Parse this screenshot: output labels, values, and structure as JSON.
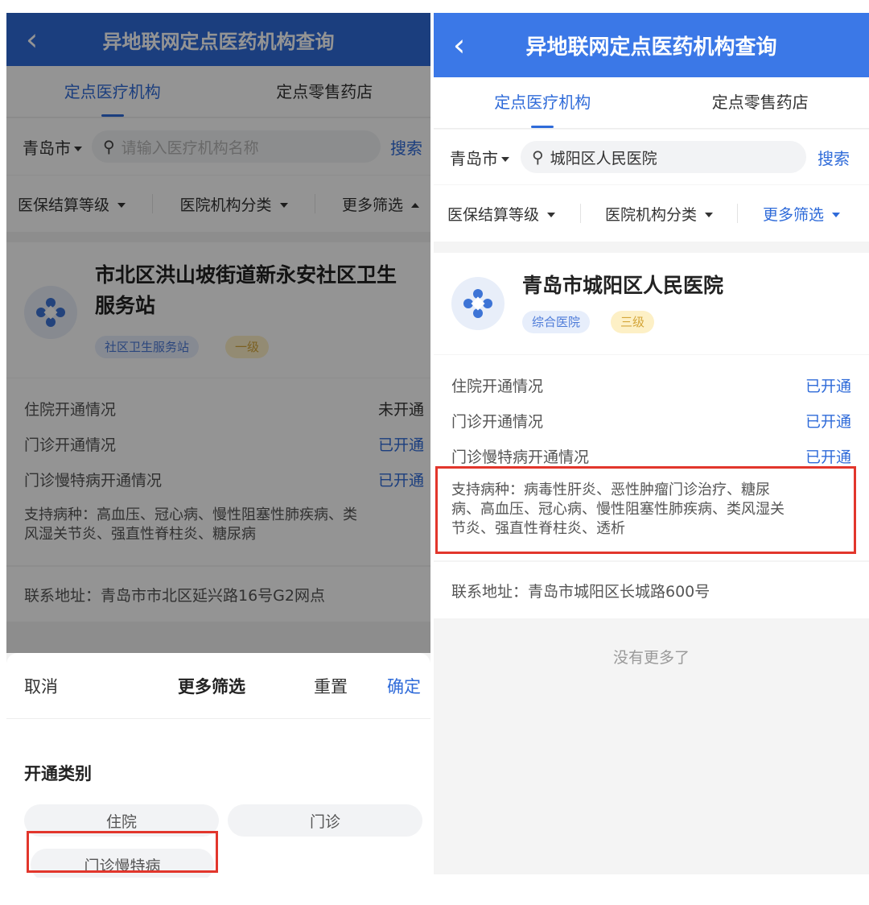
{
  "left": {
    "header": {
      "title": "异地联网定点医药机构查询",
      "back_icon": "‹"
    },
    "tabs": [
      {
        "label": "定点医疗机构",
        "active": true
      },
      {
        "label": "定点零售药店",
        "active": false
      }
    ],
    "city": "青岛市",
    "search": {
      "placeholder": "请输入医疗机构名称",
      "button": "搜索"
    },
    "filters": [
      "医保结算等级",
      "医院机构分类",
      "更多筛选"
    ],
    "card": {
      "name_line1": "市北区洪山坡街道新永安社区卫生",
      "name_line2": "服务站",
      "tags": [
        "社区卫生服务站",
        "一级"
      ],
      "rows": [
        {
          "label": "住院开通情况",
          "value": "未开通"
        },
        {
          "label": "门诊开通情况",
          "value": "已开通"
        },
        {
          "label": "门诊慢特病开通情况",
          "value": "已开通"
        }
      ],
      "diseases_line1": "支持病种：高血压、冠心病、慢性阻塞性肺疾病、类",
      "diseases_line2": "风湿关节炎、强直性脊柱炎、糖尿病",
      "address": "联系地址：青岛市市北区延兴路16号G2网点"
    },
    "sheet": {
      "cancel": "取消",
      "title": "更多筛选",
      "reset": "重置",
      "confirm": "确定",
      "section": "开通类别",
      "options": [
        "住院",
        "门诊",
        "门诊慢特病"
      ]
    }
  },
  "right": {
    "header": {
      "title": "异地联网定点医药机构查询",
      "back_icon": "‹"
    },
    "tabs": [
      {
        "label": "定点医疗机构",
        "active": true
      },
      {
        "label": "定点零售药店",
        "active": false
      }
    ],
    "city": "青岛市",
    "search": {
      "value": "城阳区人民医院",
      "button": "搜索"
    },
    "filters": [
      "医保结算等级",
      "医院机构分类",
      "更多筛选"
    ],
    "card": {
      "name": "青岛市城阳区人民医院",
      "tags": [
        "综合医院",
        "三级"
      ],
      "rows": [
        {
          "label": "住院开通情况",
          "value": "已开通"
        },
        {
          "label": "门诊开通情况",
          "value": "已开通"
        },
        {
          "label": "门诊慢特病开通情况",
          "value": "已开通"
        }
      ],
      "diseases_line1": "支持病种：病毒性肝炎、恶性肿瘤门诊治疗、糖尿",
      "diseases_line2": "病、高血压、冠心病、慢性阻塞性肺疾病、类风湿关",
      "diseases_line3": "节炎、强直性脊柱炎、透析",
      "address": "联系地址：青岛市城阳区长城路600号"
    },
    "footer": "没有更多了"
  },
  "colors": {
    "header_blue": "#2f6bd9",
    "accent": "#2f6bd9",
    "highlight_red": "#e2362c"
  }
}
